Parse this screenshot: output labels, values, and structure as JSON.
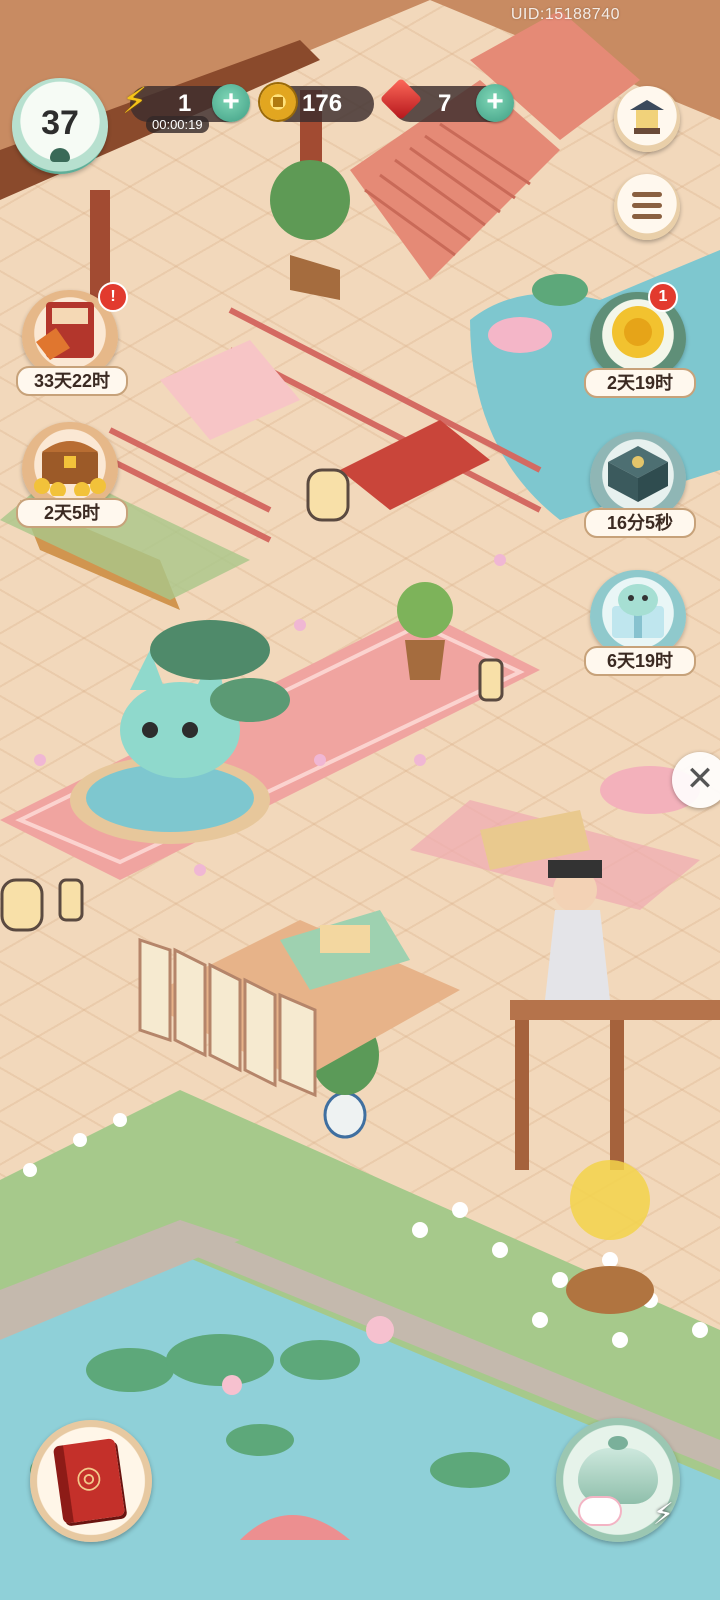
{
  "uid": "UID:15188740",
  "player": {
    "level": "37"
  },
  "resources": {
    "energy": {
      "value": "1",
      "timer": "00:00:19"
    },
    "coins": {
      "value": "176"
    },
    "gems": {
      "value": "7"
    }
  },
  "events": [
    {
      "name": "autumn-book-event",
      "countdown": "33天22时",
      "badge": "!"
    },
    {
      "name": "treasure-chest-event",
      "countdown": "2天5时"
    },
    {
      "name": "chrysanthemum-event",
      "countdown": "2天19时",
      "badge": "1"
    },
    {
      "name": "jade-box-event",
      "countdown": "16分5秒"
    },
    {
      "name": "cat-gift-event",
      "countdown": "6天19时"
    }
  ],
  "icons": {
    "energy": "lightning-icon",
    "coins": "coin-icon",
    "gems": "gem-icon",
    "add": "plus-icon",
    "shrine": "shrine-icon",
    "menu": "list-menu-icon",
    "book": "book-icon",
    "teapot": "teapot-icon",
    "close": "close-icon"
  },
  "colors": {
    "accent_green": "#3f9e84",
    "badge_red": "#e23a2e",
    "hud_dark": "#3c2d2d"
  }
}
